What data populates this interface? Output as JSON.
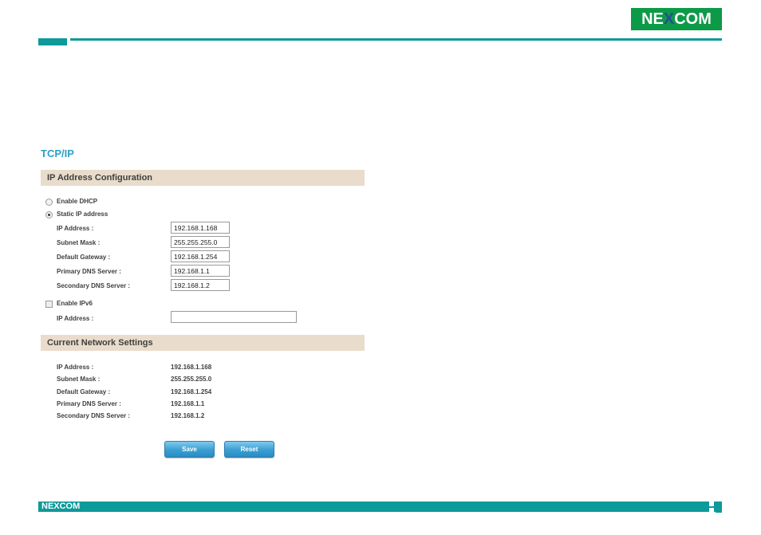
{
  "header": {
    "logo_text_a": "NE",
    "logo_text_x": "X",
    "logo_text_b": "COM"
  },
  "page_title": "TCP/IP",
  "ip_config": {
    "header": "IP Address Configuration",
    "enable_dhcp_label": "Enable DHCP",
    "enable_dhcp_checked": false,
    "static_ip_label": "Static IP address",
    "static_ip_checked": true,
    "fields": [
      {
        "label": "IP Address :",
        "value": "192.168.1.168"
      },
      {
        "label": "Subnet Mask :",
        "value": "255.255.255.0"
      },
      {
        "label": "Default Gateway :",
        "value": "192.168.1.254"
      },
      {
        "label": "Primary DNS Server :",
        "value": "192.168.1.1"
      },
      {
        "label": "Secondary DNS Server :",
        "value": "192.168.1.2"
      }
    ],
    "enable_ipv6_label": "Enable IPv6",
    "enable_ipv6_checked": false,
    "ipv6_address_label": "IP Address :",
    "ipv6_address_value": ""
  },
  "current_settings": {
    "header": "Current Network Settings",
    "rows": [
      {
        "label": "IP Address :",
        "value": "192.168.1.168"
      },
      {
        "label": "Subnet Mask :",
        "value": "255.255.255.0"
      },
      {
        "label": "Default Gateway :",
        "value": "192.168.1.254"
      },
      {
        "label": "Primary DNS Server :",
        "value": "192.168.1.1"
      },
      {
        "label": "Secondary DNS Server :",
        "value": "192.168.1.2"
      }
    ]
  },
  "buttons": {
    "save_label": "Save",
    "reset_label": "Reset"
  },
  "footer": {
    "logo_text": "NEXCOM"
  },
  "colors": {
    "accent_teal": "#0d9a9a",
    "logo_green": "#0c9a47",
    "section_header_bg": "#e9dccb",
    "title_blue": "#2f9ec6",
    "button_blue": "#3a9ed2"
  }
}
